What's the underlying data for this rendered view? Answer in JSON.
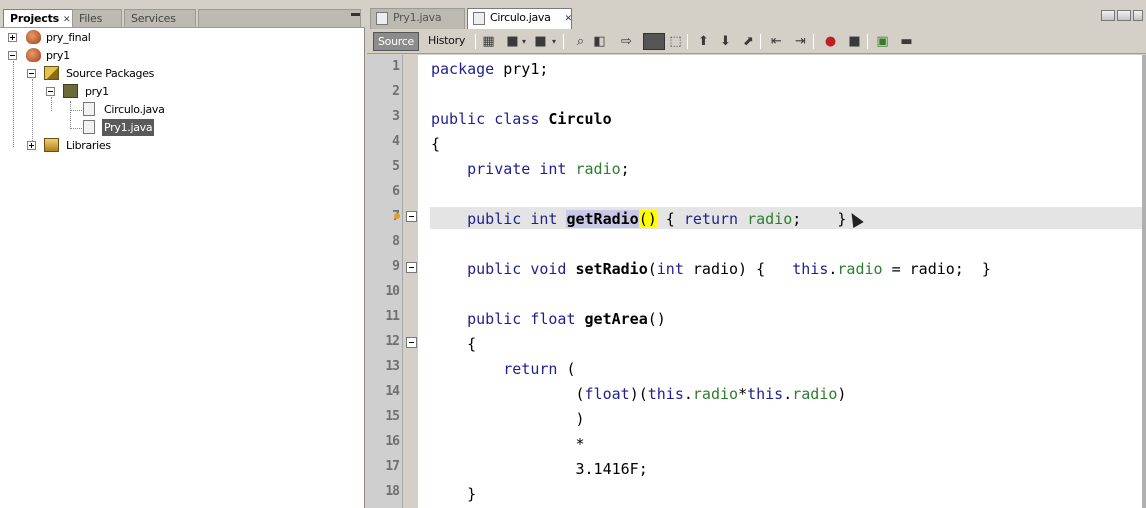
{
  "projects_panel": {
    "tabs": [
      {
        "label": "Projects",
        "close": "✕"
      },
      {
        "label": "Files",
        "close": ""
      },
      {
        "label": "Services",
        "close": ""
      }
    ],
    "tree": [
      {
        "label": "pry_final",
        "icon": "project-icon"
      },
      {
        "label": "pry1",
        "icon": "project-icon"
      },
      {
        "label": "Source Packages",
        "icon": "source-packages-icon"
      },
      {
        "label": "pry1",
        "icon": "package-icon"
      },
      {
        "label": "Circulo.java",
        "icon": "java-file-icon"
      },
      {
        "label": "Pry1.java",
        "icon": "java-file-icon",
        "selected": true
      },
      {
        "label": "Libraries",
        "icon": "libraries-icon"
      }
    ]
  },
  "editor": {
    "tabs": [
      {
        "label": "Pry1.java",
        "active": false
      },
      {
        "label": "Circulo.java",
        "active": true,
        "close": "✕"
      }
    ],
    "toolbar": {
      "source_label": "Source",
      "history_label": "History"
    },
    "line_numbers": [
      "1",
      "2",
      "3",
      "4",
      "5",
      "6",
      "7",
      "8",
      "9",
      "10",
      "11",
      "12",
      "13",
      "14",
      "15",
      "16",
      "17",
      "18"
    ],
    "current_line": 7
  },
  "colors": {
    "keyword": "#1f1f8f",
    "field": "#2e7d2e",
    "current_line_bg": "#e4e4e4",
    "brace_match": "#ffff00",
    "identifier_highlight": "#c8c8e8"
  }
}
